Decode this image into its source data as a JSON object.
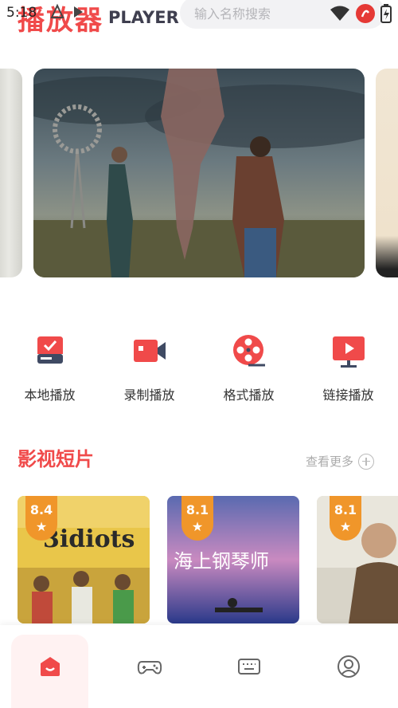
{
  "status": {
    "time": "5:18"
  },
  "header": {
    "brand_cn": "播放器",
    "brand_en": "PLAYER"
  },
  "search": {
    "placeholder": "输入名称搜索"
  },
  "banner": {
    "image": "movie-poster-windmill-storm"
  },
  "actions": [
    {
      "label": "本地播放",
      "icon": "storage-icon"
    },
    {
      "label": "录制播放",
      "icon": "camera-icon"
    },
    {
      "label": "格式播放",
      "icon": "film-reel-icon"
    },
    {
      "label": "链接播放",
      "icon": "tv-play-icon"
    }
  ],
  "section": {
    "title": "影视短片",
    "more_label": "查看更多"
  },
  "movies": [
    {
      "rating": "8.4",
      "poster_text": "3idiots"
    },
    {
      "rating": "8.1",
      "poster_text": "海上钢琴师"
    },
    {
      "rating": "8.1",
      "poster_text": ""
    }
  ],
  "nav": [
    {
      "icon": "home-icon",
      "active": true
    },
    {
      "icon": "gamepad-icon",
      "active": false
    },
    {
      "icon": "keyboard-icon",
      "active": false
    },
    {
      "icon": "user-icon",
      "active": false
    }
  ],
  "colors": {
    "accent": "#f04a4a",
    "rating_badge": "#f0962a",
    "search_bg": "#f2f2f4"
  }
}
